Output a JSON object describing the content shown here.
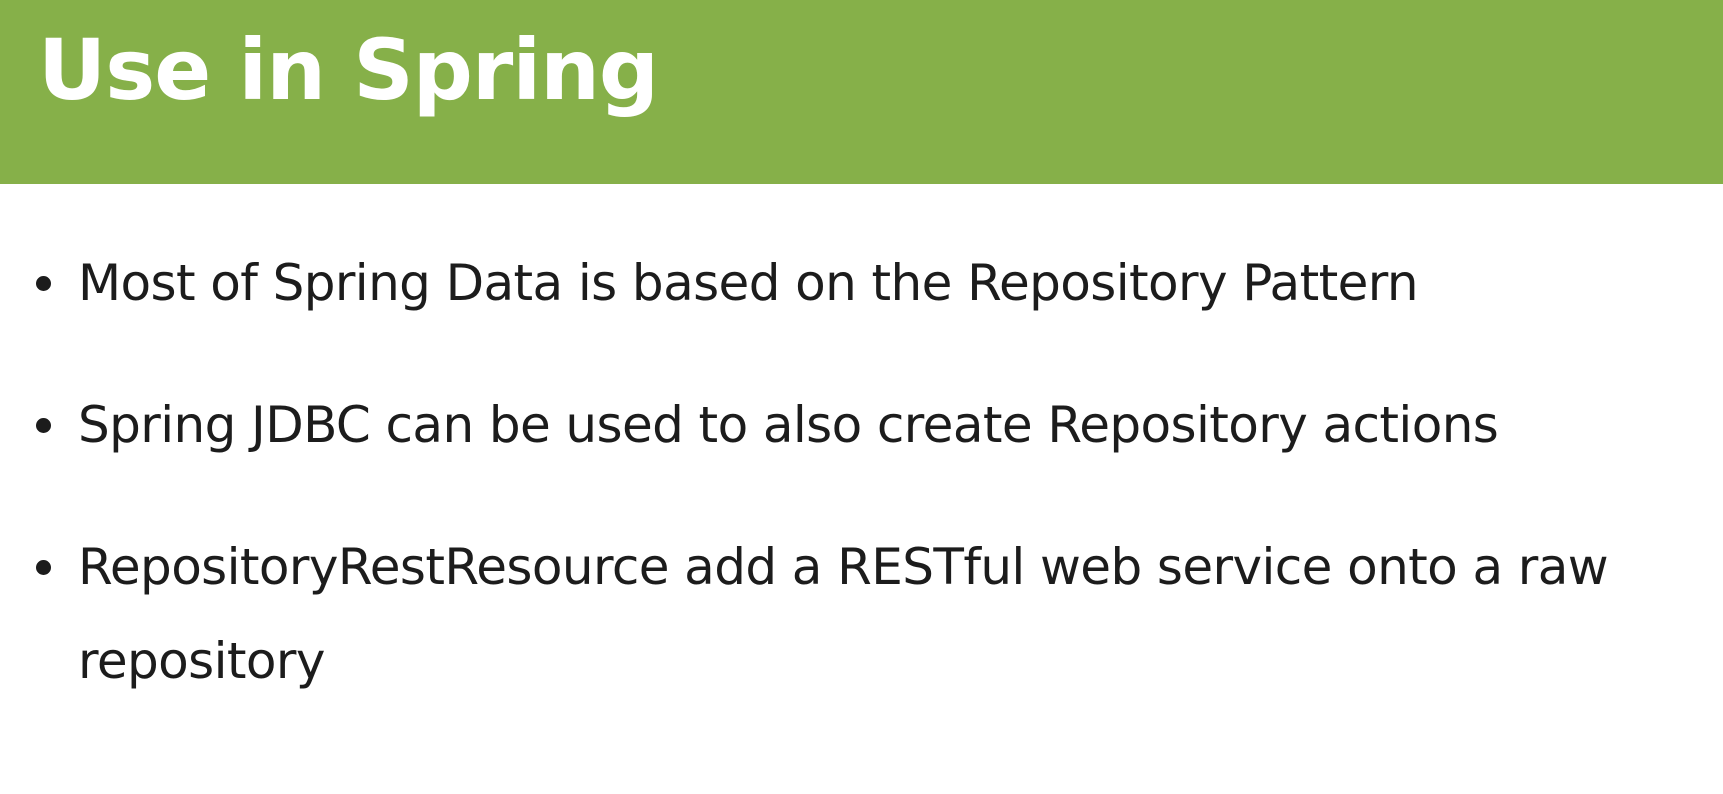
{
  "slide": {
    "title": "Use in Spring",
    "bullets": [
      "Most of Spring Data is based on the Repository Pattern",
      "Spring JDBC can be used to also create Repository actions",
      "RepositoryRestResource add a RESTful web service onto a raw repository"
    ]
  },
  "colors": {
    "header_background": "#86b049",
    "title_text": "#ffffff",
    "body_text": "#1c1c1c",
    "background": "#ffffff"
  }
}
